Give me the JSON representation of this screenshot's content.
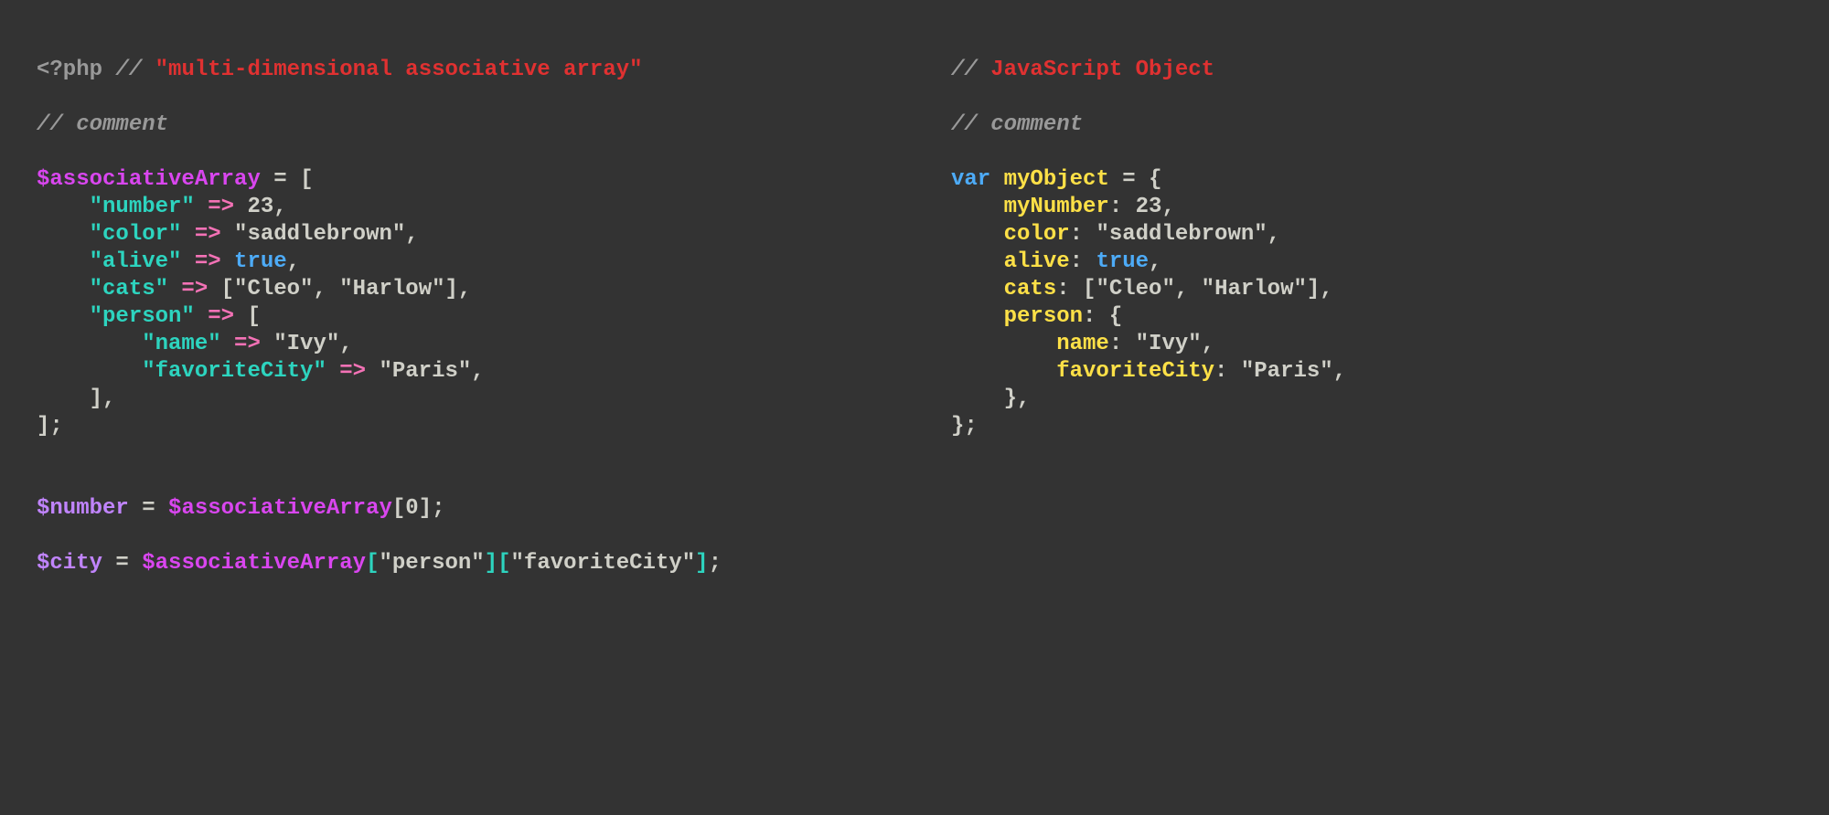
{
  "left": {
    "open_tag": "<?php",
    "comment_marker": "//",
    "title_comment": "\"multi-dimensional associative array\"",
    "line_comment": "comment",
    "var_assoc": "$associativeArray",
    "eq": " = ",
    "open_bracket": "[",
    "k_number": "\"number\"",
    "arrow": " => ",
    "v_number": "23",
    "comma": ",",
    "k_color": "\"color\"",
    "v_color": "\"saddlebrown\"",
    "k_alive": "\"alive\"",
    "v_alive": "true",
    "k_cats": "\"cats\"",
    "cats_open": "[",
    "cat1": "\"Cleo\"",
    "cat_sep": ", ",
    "cat2": "\"Harlow\"",
    "cats_close": "]",
    "k_person": "\"person\"",
    "person_open": "[",
    "k_name": "\"name\"",
    "v_name": "\"Ivy\"",
    "k_favcity": "\"favoriteCity\"",
    "v_favcity": "\"Paris\"",
    "person_close": "]",
    "close_bracket": "];",
    "var_number": "$number",
    "idx0": "[0]",
    "semi": ";",
    "var_city": "$city",
    "idx_person_open": "[",
    "idx_person_key": "\"person\"",
    "idx_person_close": "]",
    "idx_fav_open": "[",
    "idx_fav_key": "\"favoriteCity\"",
    "idx_fav_close": "]"
  },
  "right": {
    "comment_marker": "//",
    "title_comment": "JavaScript Object",
    "line_comment": "comment",
    "kw_var": "var",
    "var_obj": "myObject",
    "eq": " = ",
    "open_brace": "{",
    "k_mynumber": "myNumber",
    "colon": ": ",
    "v_number": "23",
    "comma": ",",
    "k_color": "color",
    "v_color": "\"saddlebrown\"",
    "k_alive": "alive",
    "v_alive": "true",
    "k_cats": "cats",
    "cats_open": "[",
    "cat1": "\"Cleo\"",
    "cat_sep": ", ",
    "cat2": "\"Harlow\"",
    "cats_close": "]",
    "k_person": "person",
    "person_open": "{",
    "k_name": "name",
    "v_name": "\"Ivy\"",
    "k_favcity": "favoriteCity",
    "v_favcity": "\"Paris\"",
    "person_close": "}",
    "close_brace": "};"
  }
}
